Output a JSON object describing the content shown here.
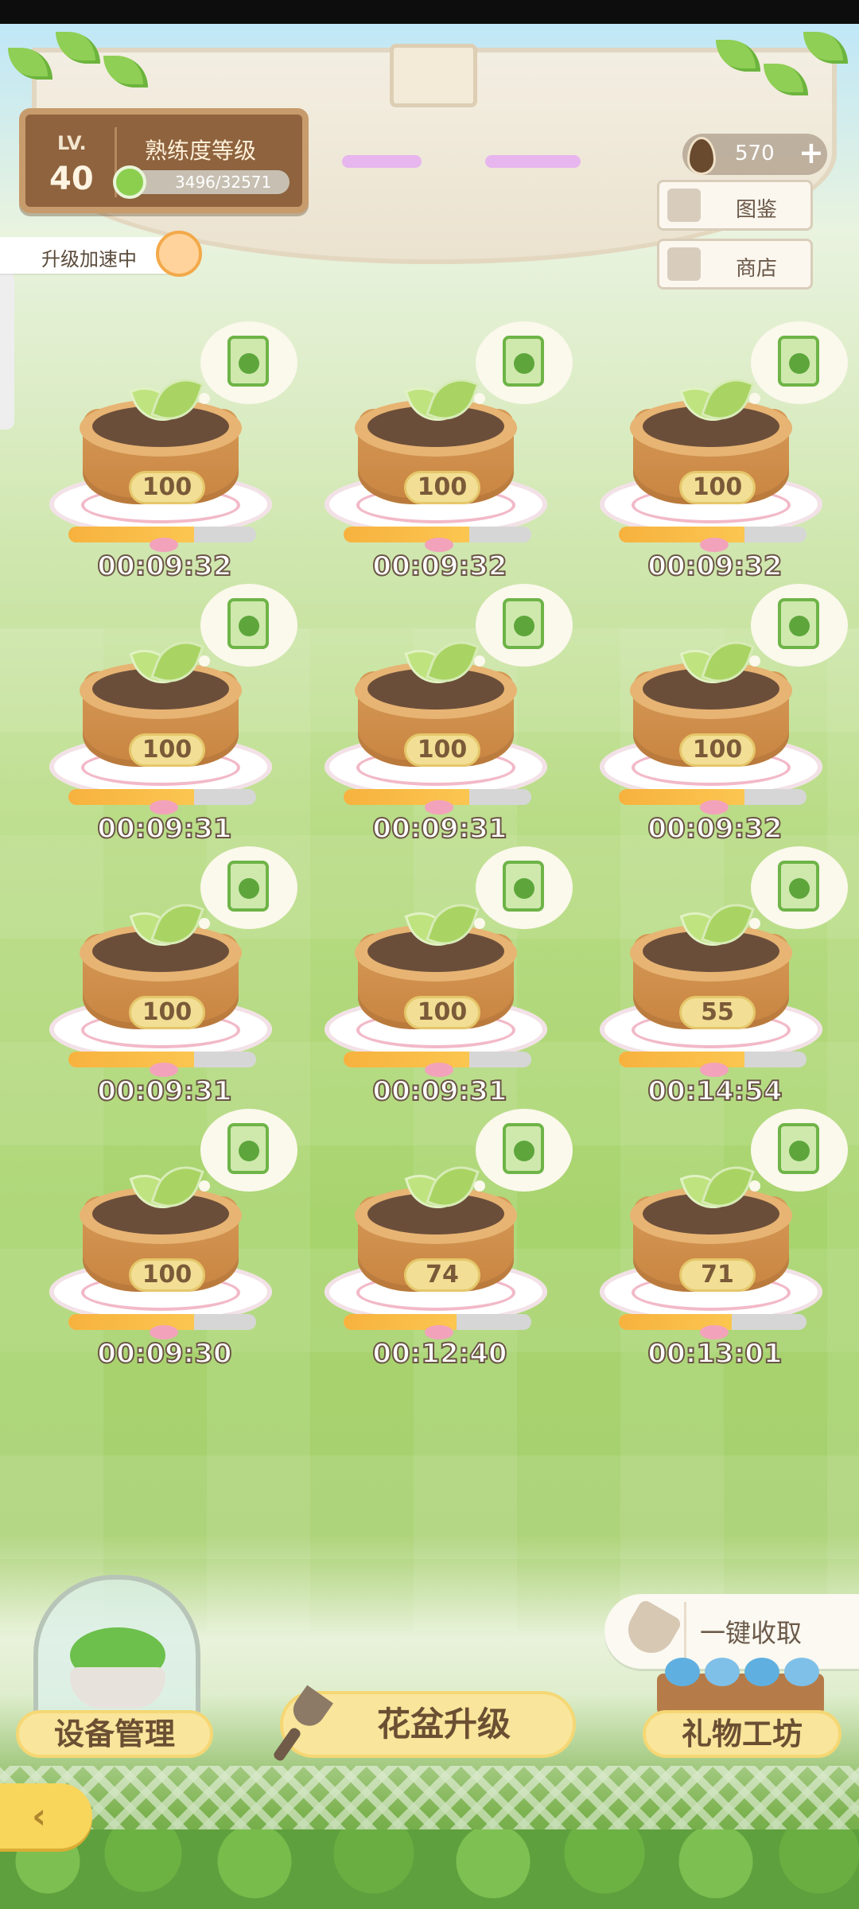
{
  "level": {
    "label": "LV.",
    "value": "40"
  },
  "proficiency": {
    "title": "熟练度等级",
    "progress_text": "3496/32571",
    "fraction": 0.107
  },
  "accelerate_tag": "升级加速中",
  "currency": {
    "value": "570"
  },
  "side_buttons": [
    {
      "label": "图鉴"
    },
    {
      "label": "商店"
    }
  ],
  "pots": [
    {
      "level": "100",
      "timer": "00:09:32",
      "progress": 0.67
    },
    {
      "level": "100",
      "timer": "00:09:32",
      "progress": 0.67
    },
    {
      "level": "100",
      "timer": "00:09:32",
      "progress": 0.67
    },
    {
      "level": "100",
      "timer": "00:09:31",
      "progress": 0.67
    },
    {
      "level": "100",
      "timer": "00:09:31",
      "progress": 0.67
    },
    {
      "level": "100",
      "timer": "00:09:32",
      "progress": 0.67
    },
    {
      "level": "100",
      "timer": "00:09:31",
      "progress": 0.67
    },
    {
      "level": "100",
      "timer": "00:09:31",
      "progress": 0.67
    },
    {
      "level": "55",
      "timer": "00:14:54",
      "progress": 0.67
    },
    {
      "level": "100",
      "timer": "00:09:30",
      "progress": 0.67
    },
    {
      "level": "74",
      "timer": "00:12:40",
      "progress": 0.6
    },
    {
      "level": "71",
      "timer": "00:13:01",
      "progress": 0.6
    }
  ],
  "bottom": {
    "collect_all": "一键收取",
    "device_manage": "设备管理",
    "pot_upgrade": "花盆升级",
    "gift_workshop": "礼物工坊"
  },
  "colors": {
    "accent_yellow": "#f9e59b",
    "wood_brown": "#8e633e",
    "progress_orange": "#f7b23e"
  }
}
